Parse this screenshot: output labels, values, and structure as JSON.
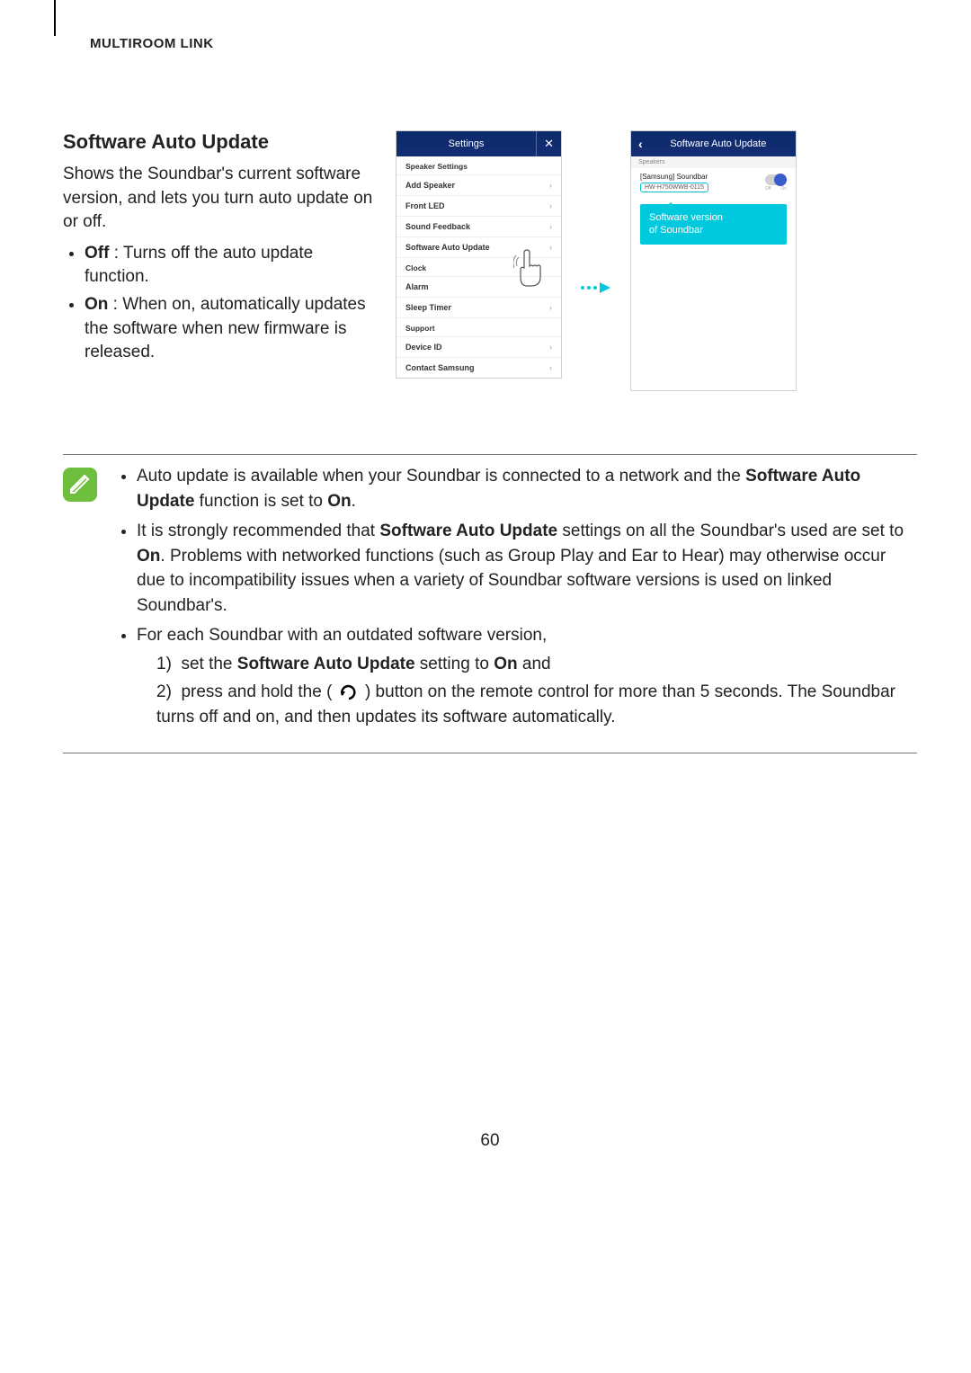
{
  "header": "MULTIROOM LINK",
  "section_title": "Software Auto Update",
  "intro": "Shows the Soundbar's current software version, and lets you turn auto update on or off.",
  "bullets": {
    "off_label": "Off",
    "off_text": " : Turns off the auto update function.",
    "on_label": "On",
    "on_text": " : When on, automatically updates the software when new firmware is released."
  },
  "screen1": {
    "title": "Settings",
    "section1": "Speaker Settings",
    "items1": [
      "Add Speaker",
      "Front LED",
      "Sound Feedback",
      "Software Auto Update"
    ],
    "section2": "Clock",
    "items2": [
      "Alarm",
      "Sleep Timer"
    ],
    "section3": "Support",
    "items3": [
      "Device ID",
      "Contact Samsung"
    ]
  },
  "screen2": {
    "title": "Software Auto Update",
    "speakers_label": "Speakers",
    "speaker_name": "[Samsung] Soundbar",
    "speaker_version": "HW-H750WWB-0115",
    "toggle_off": "Off",
    "toggle_on": "On",
    "callout_line1": "Software version",
    "callout_line2": "of Soundbar"
  },
  "notes": {
    "n1_a": "Auto update is available when your Soundbar is connected to a network and the ",
    "n1_b": "Software Auto Update",
    "n1_c": " function is set to ",
    "n1_d": "On",
    "n1_e": ".",
    "n2_a": "It is strongly recommended that ",
    "n2_b": "Software Auto Update",
    "n2_c": " settings on all the Soundbar's used are set to ",
    "n2_d": "On",
    "n2_e": ". Problems with networked functions (such as Group Play and Ear to Hear) may otherwise occur due to incompatibility issues when a variety of Soundbar software versions is used on linked Soundbar's.",
    "n3": "For each Soundbar with an outdated software version,",
    "step1_a": "1)  set the ",
    "step1_b": "Software Auto Update",
    "step1_c": " setting to ",
    "step1_d": "On",
    "step1_e": " and",
    "step2_a": "2)  press and hold the ( ",
    "step2_b": " ) button on the remote control for more than 5 seconds. The Soundbar turns off and on, and then updates its software automatically."
  },
  "page_number": "60"
}
